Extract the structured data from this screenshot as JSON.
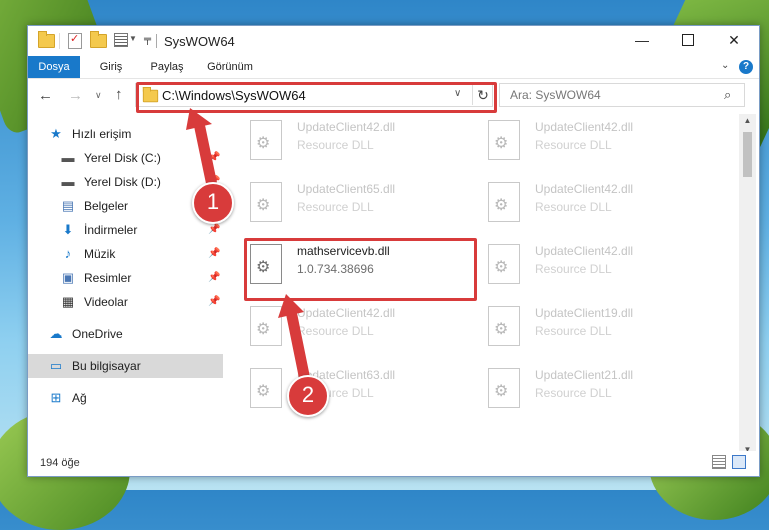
{
  "window": {
    "title": "SysWOW64",
    "controls": {
      "minimize": "—",
      "maximize": "",
      "close": "✕"
    }
  },
  "ribbon": {
    "tabs": [
      "Dosya",
      "Giriş",
      "Paylaş",
      "Görünüm"
    ],
    "help": "?"
  },
  "navigation": {
    "address": "C:\\Windows\\SysWOW64",
    "search_placeholder": "Ara: SysWOW64"
  },
  "sidebar": {
    "items": [
      {
        "label": "Hızlı erişim",
        "icon": "star-icon",
        "pinned": false
      },
      {
        "label": "Yerel Disk (C:)",
        "icon": "drive-icon",
        "pinned": true
      },
      {
        "label": "Yerel Disk (D:)",
        "icon": "drive-icon",
        "pinned": true
      },
      {
        "label": "Belgeler",
        "icon": "documents-icon",
        "pinned": true
      },
      {
        "label": "İndirmeler",
        "icon": "download-icon",
        "pinned": true
      },
      {
        "label": "Müzik",
        "icon": "music-icon",
        "pinned": true
      },
      {
        "label": "Resimler",
        "icon": "pictures-icon",
        "pinned": true
      },
      {
        "label": "Videolar",
        "icon": "video-icon",
        "pinned": true
      },
      {
        "label": "OneDrive",
        "icon": "cloud-icon",
        "pinned": false
      },
      {
        "label": "Bu bilgisayar",
        "icon": "computer-icon",
        "pinned": false,
        "selected": true
      },
      {
        "label": "Ağ",
        "icon": "network-icon",
        "pinned": false
      }
    ]
  },
  "files": {
    "left_column": [
      {
        "name": "UpdateClient42.dll",
        "type": "Resource DLL"
      },
      {
        "name": "UpdateClient65.dll",
        "type": "Resource DLL"
      },
      {
        "name": "mathservicevb.dll",
        "type": "1.0.734.38696",
        "highlighted": true
      },
      {
        "name": "UpdateClient42.dll",
        "type": "Resource DLL"
      },
      {
        "name": "UpdateClient63.dll",
        "type": "Resource DLL"
      }
    ],
    "right_column": [
      {
        "name": "UpdateClient42.dll",
        "type": "Resource DLL"
      },
      {
        "name": "UpdateClient42.dll",
        "type": "Resource DLL"
      },
      {
        "name": "UpdateClient42.dll",
        "type": "Resource DLL"
      },
      {
        "name": "UpdateClient19.dll",
        "type": "Resource DLL"
      },
      {
        "name": "UpdateClient21.dll",
        "type": "Resource DLL"
      }
    ]
  },
  "status": {
    "item_count": "194 öğe"
  },
  "annotations": {
    "step1": "1",
    "step2": "2",
    "highlight_color": "#d83b3b"
  }
}
